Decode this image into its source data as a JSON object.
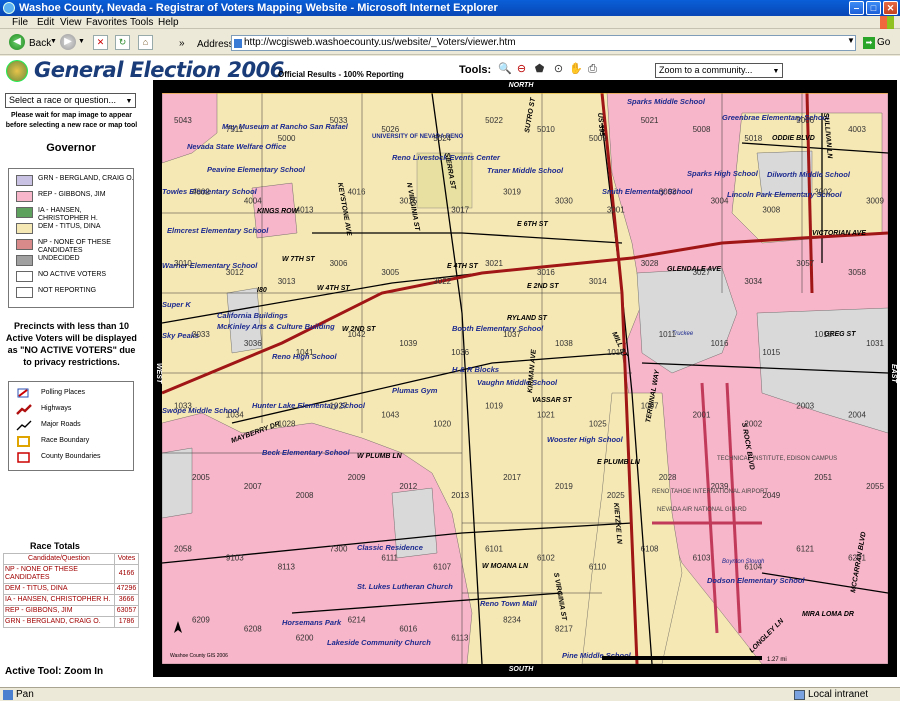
{
  "window": {
    "title": "Washoe County, Nevada - Registrar of Voters Mapping Website - Microsoft Internet Explorer"
  },
  "menu": [
    "File",
    "Edit",
    "View",
    "Favorites",
    "Tools",
    "Help"
  ],
  "toolbar": {
    "back": "Back",
    "address_label": "Address",
    "address_value": "http://wcgisweb.washoecounty.us/website/_Voters/viewer.htm",
    "go": "Go"
  },
  "app": {
    "title": "General Election 2006",
    "results_note": "Official Results - 100% Reporting",
    "tools_label": "Tools:",
    "zoom_select": "Zoom to a community...",
    "race_select": "Select a race or question...",
    "wait_note": "Please wait for map image to appear before selecting a new race or map tool",
    "race_title": "Governor",
    "privacy_note": "Precincts with less than 10 Active Voters will be displayed as \"NO ACTIVE VOTERS\" due to privacy restrictions.",
    "active_tool": "Active Tool:   Zoom In"
  },
  "race_legend": [
    {
      "label": "GRN - BERGLAND, CRAIG O.",
      "color": "#c9c2e2"
    },
    {
      "label": "REP - GIBBONS, JIM",
      "color": "#f7b6c9"
    },
    {
      "label": "IA - HANSEN, CHRISTOPHER H.",
      "color": "#5ea05e"
    },
    {
      "label": "DEM - TITUS, DINA",
      "color": "#f6e8b5"
    },
    {
      "label": "NP - NONE OF THESE CANDIDATES",
      "color": "#d88a8a"
    },
    {
      "label": "UNDECIDED",
      "color": "#a0a0a0"
    },
    {
      "label": "NO ACTIVE VOTERS",
      "color": "#ffffff"
    },
    {
      "label": "NOT REPORTING",
      "color": "#ffffff"
    }
  ],
  "map_legend": [
    {
      "label": "Polling Places",
      "icon": "polling-place-icon"
    },
    {
      "label": "Highways",
      "icon": "highway-icon"
    },
    {
      "label": "Major Roads",
      "icon": "major-road-icon"
    },
    {
      "label": "Race Boundary",
      "icon": "race-boundary-icon"
    },
    {
      "label": "County Boundaries",
      "icon": "county-boundary-icon"
    }
  ],
  "totals": {
    "title": "Race Totals",
    "headers": [
      "Candidate/Question",
      "Votes"
    ],
    "rows": [
      {
        "candidate": "NP - NONE OF THESE CANDIDATES",
        "votes": "4166"
      },
      {
        "candidate": "DEM - TITUS, DINA",
        "votes": "47296"
      },
      {
        "candidate": "IA - HANSEN, CHRISTOPHER H.",
        "votes": "3666"
      },
      {
        "candidate": "REP - GIBBONS, JIM",
        "votes": "63057"
      },
      {
        "candidate": "GRN - BERGLAND, CRAIG O.",
        "votes": "1786"
      }
    ]
  },
  "map": {
    "north": "NORTH",
    "south": "SOUTH",
    "east": "EAST",
    "west": "WEST",
    "credit": "Washoe County GIS 2006",
    "scale": "1.27 mi",
    "colors": {
      "dem": "#f6e8b5",
      "rep": "#f7b6c9",
      "none": "#d9d9d9",
      "green": "#c9d9a0"
    }
  },
  "map_labels": {
    "places": [
      "May Museum at Rancho San Rafael",
      "Nevada State Welfare Office",
      "UNIVERSITY OF NEVADA RENO",
      "Reno Livestock Events Center",
      "Traner Middle School",
      "Peavine Elementary School",
      "Towles Elementary School",
      "Elmcrest Elementary School",
      "Warner Elementary School",
      "Super K",
      "California Buildings",
      "McKinley Arts & Culture Building",
      "Sky Peaks",
      "Reno High School",
      "Hunter Lake Elementary School",
      "Swope Middle School",
      "Plumas Gym",
      "H & R Blocks",
      "Vaughn Middle School",
      "Booth Elementary School",
      "Wooster High School",
      "Beck Elementary School",
      "Classic Residence",
      "St. Lukes Lutheran Church",
      "Reno Town Mall",
      "Horsemans Park",
      "Lakeside Community Church",
      "Pine Middle School",
      "Sparks Middle School",
      "Greenbrae Elementary School",
      "Sparks High School",
      "Dilworth Middle School",
      "Smith Elementary School",
      "Lincoln Park Elementary School",
      "Dodson Elementary School",
      "TECHNICAL INSTITUTE, EDISON CAMPUS",
      "RENO TAHOE INTERNATIONAL AIRPORT",
      "NEVADA AIR NATIONAL GUARD",
      "Boynton Slough",
      "Truckee"
    ],
    "streets": [
      "KINGS ROW",
      "W 7TH ST",
      "W 4TH ST",
      "W 2ND ST",
      "E 6TH ST",
      "E 4TH ST",
      "E 2ND ST",
      "RYLAND ST",
      "VASSAR ST",
      "E PLUMB LN",
      "W PLUMB LN",
      "W MOANA LN",
      "GLENDALE AVE",
      "GREG ST",
      "VICTORIAN AVE",
      "ODDIE BLVD",
      "MIRA LOMA DR",
      "I80",
      "N VIRGINIA ST",
      "S VIRGINIA ST",
      "KEYSTONE AVE",
      "MAYBERRY DR",
      "SUTRO ST",
      "MILL ST",
      "KIETZKE LN",
      "KIRMAN AVE",
      "TERMINAL WAY",
      "S ROCK BLVD",
      "LONGLEY LN",
      "SULLIVAN LN",
      "MCCARRAN BLVD",
      "SIERRA ST",
      "US 395"
    ],
    "precincts": [
      "5043",
      "7511",
      "5000",
      "5033",
      "5026",
      "5024",
      "5022",
      "5010",
      "5009",
      "5021",
      "5008",
      "5018",
      "5006",
      "4003",
      "4002",
      "4004",
      "4013",
      "4016",
      "3015",
      "3017",
      "3019",
      "3030",
      "3001",
      "3003",
      "3004",
      "3008",
      "3002",
      "3009",
      "3010",
      "3012",
      "3013",
      "3006",
      "3005",
      "3022",
      "3021",
      "3016",
      "3014",
      "3028",
      "3027",
      "3034",
      "3057",
      "3058",
      "3033",
      "3036",
      "1041",
      "1042",
      "1039",
      "1036",
      "1037",
      "1038",
      "1012",
      "1011",
      "1016",
      "1015",
      "1018",
      "1031",
      "1033",
      "1034",
      "1028",
      "1027",
      "1043",
      "1020",
      "1019",
      "1021",
      "1025",
      "1007",
      "2001",
      "2002",
      "2003",
      "2004",
      "2005",
      "2007",
      "2008",
      "2009",
      "2012",
      "2013",
      "2017",
      "2019",
      "2025",
      "2028",
      "2039",
      "2049",
      "2051",
      "2055",
      "2058",
      "9103",
      "8113",
      "7300",
      "6111",
      "6107",
      "6101",
      "6102",
      "6110",
      "6108",
      "6103",
      "6104",
      "6121",
      "6201",
      "6209",
      "6208",
      "6200",
      "6214",
      "6016",
      "6113",
      "8234",
      "8217"
    ]
  }
}
